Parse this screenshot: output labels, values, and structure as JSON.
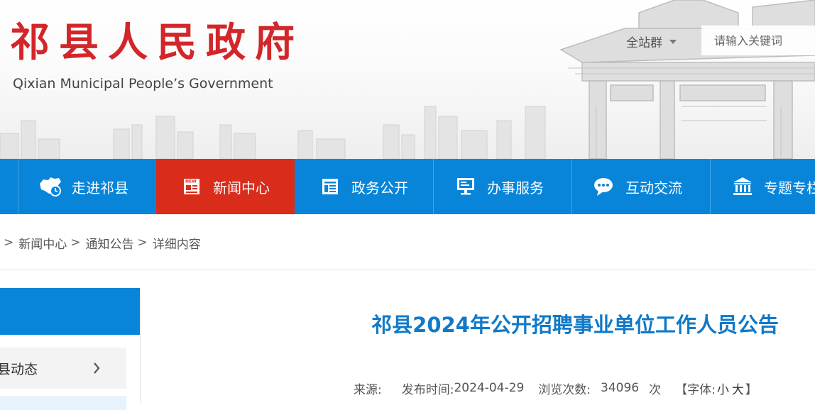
{
  "header": {
    "title": "祁县人民政府",
    "subtitle": "Qixian Municipal People’s Government",
    "site_group_label": "全站群",
    "search_placeholder": "请输入关键词"
  },
  "nav": {
    "items": [
      {
        "label": "走进祁县",
        "icon": "china-map-icon",
        "active": false
      },
      {
        "label": "新闻中心",
        "icon": "newspaper-icon",
        "active": true
      },
      {
        "label": "政务公开",
        "icon": "document-panel-icon",
        "active": false
      },
      {
        "label": "办事服务",
        "icon": "monitor-icon",
        "active": false
      },
      {
        "label": "互动交流",
        "icon": "chat-bubble-icon",
        "active": false
      },
      {
        "label": "专题专栏",
        "icon": "building-columns-icon",
        "active": false
      }
    ]
  },
  "breadcrumb": {
    "items": [
      "新闻中心",
      "通知公告",
      "详细内容"
    ],
    "separator": ">"
  },
  "sidebar": {
    "items": [
      {
        "label": "县动态"
      }
    ]
  },
  "article": {
    "title": "祁县2024年公开招聘事业单位工作人员公告",
    "source_label": "来源:",
    "publish_label": "发布时间:",
    "publish_date": "2024-04-29",
    "views_label": "浏览次数:",
    "views_count": "34096",
    "views_unit": "次",
    "font_open": "【字体:",
    "font_small": "小",
    "font_large": "大",
    "font_close": "】"
  },
  "colors": {
    "brand_red": "#d2262a",
    "nav_blue": "#0885d9",
    "nav_active_red": "#d92c1b",
    "title_blue": "#1079c9"
  }
}
